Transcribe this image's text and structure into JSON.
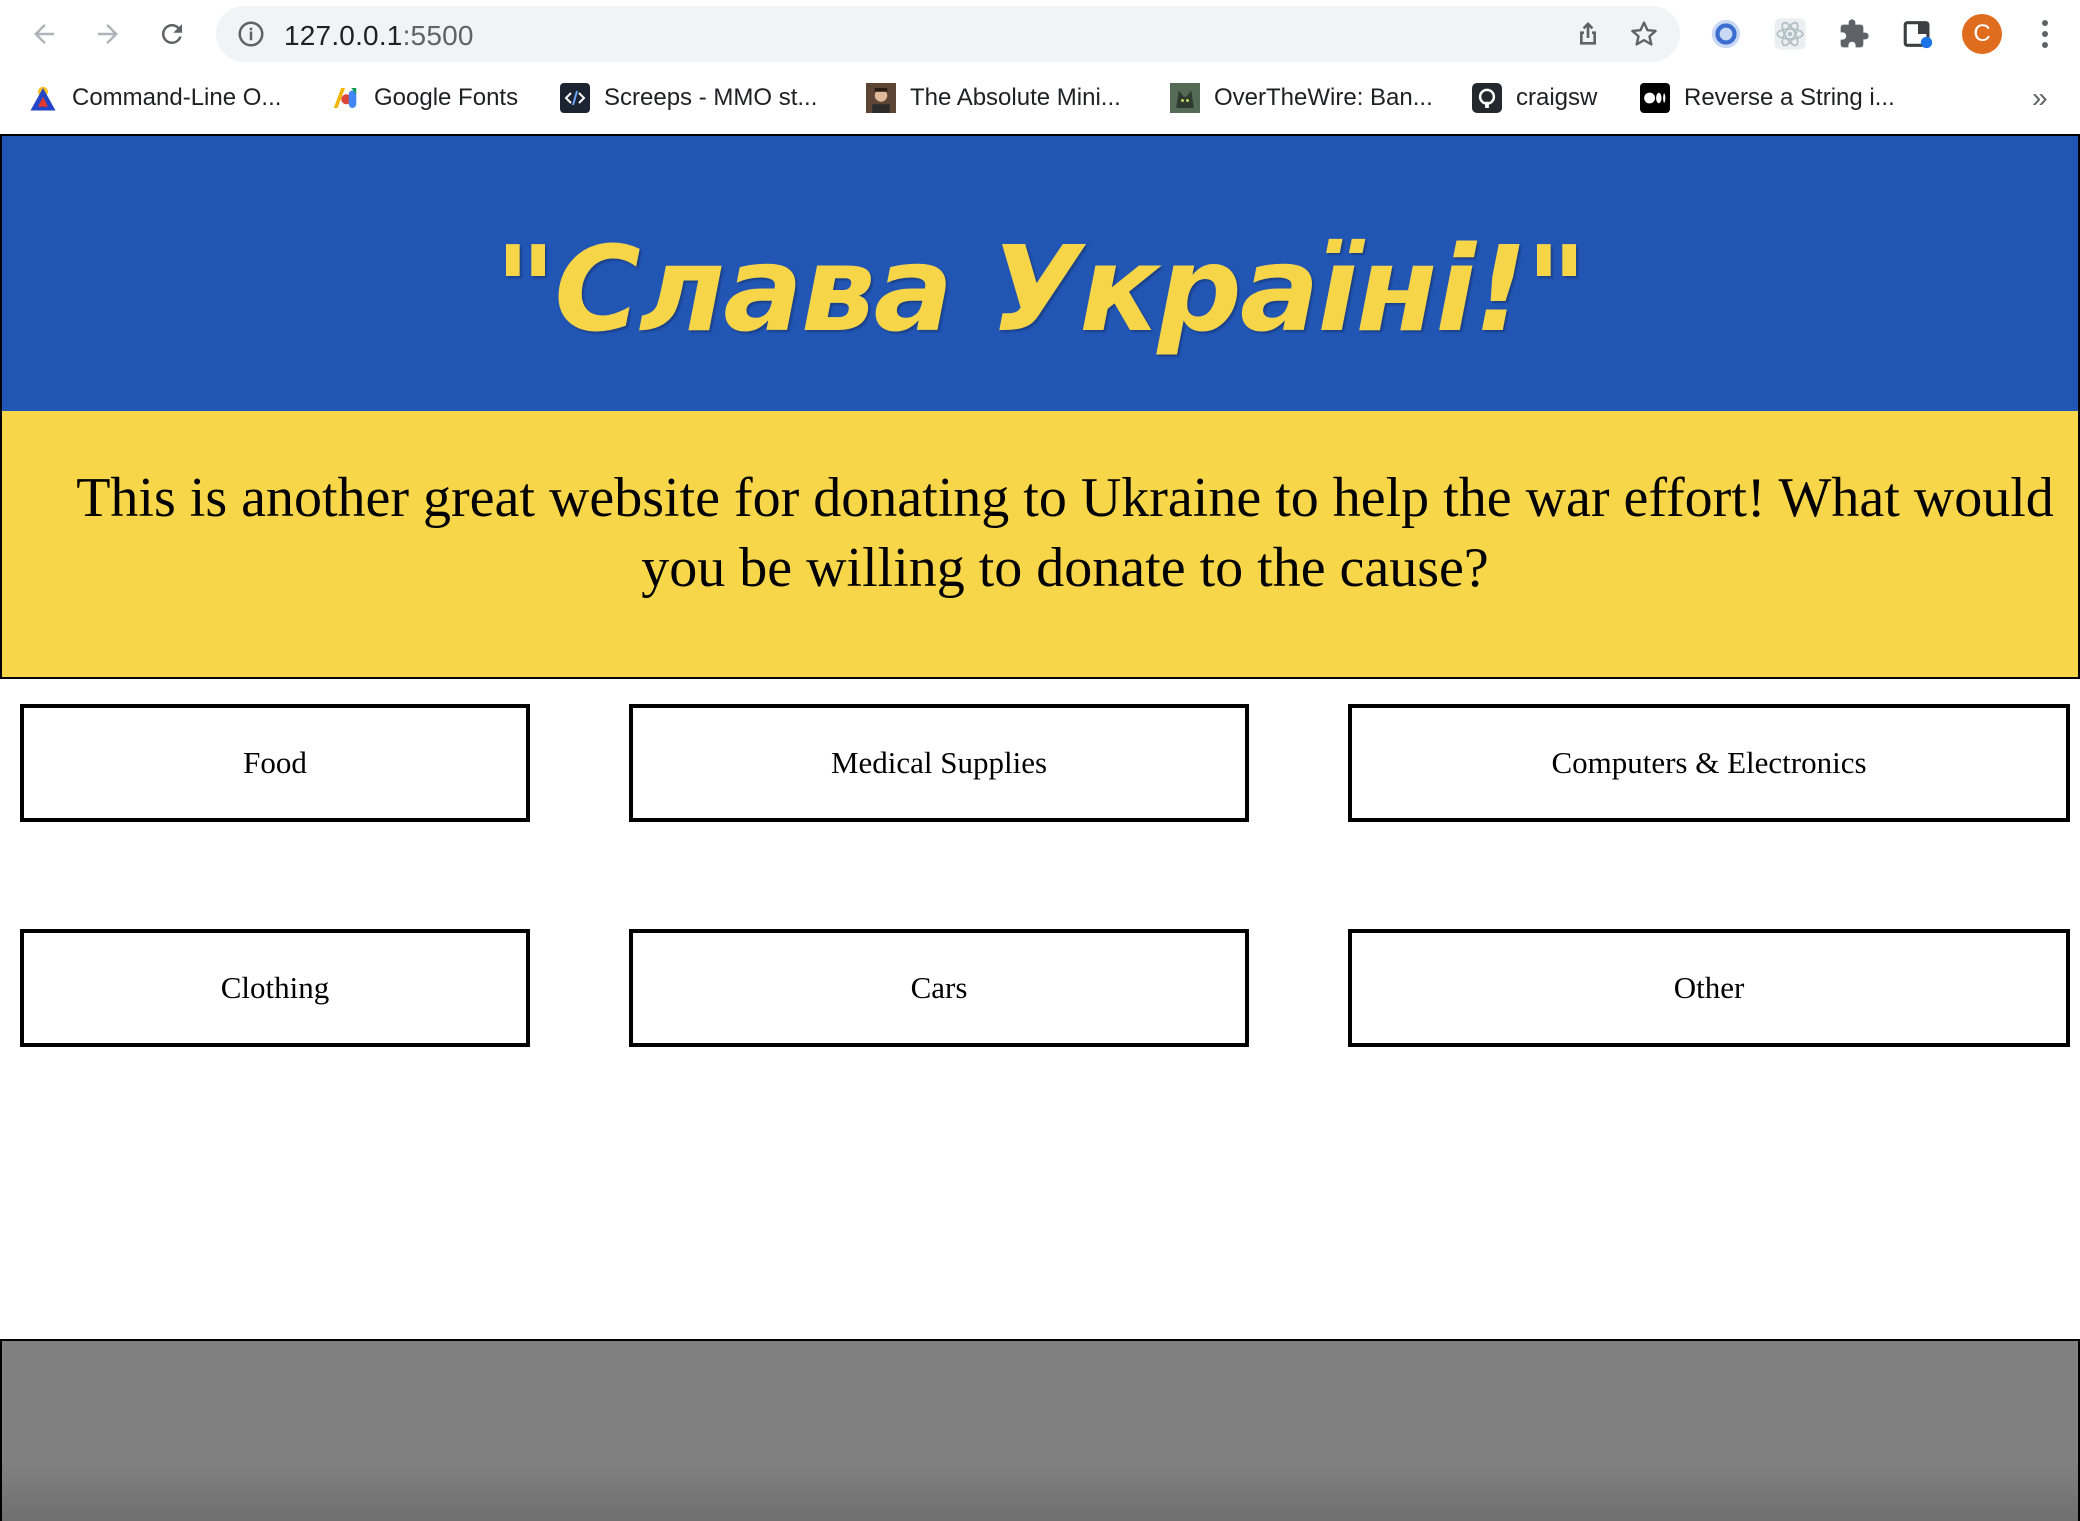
{
  "browser": {
    "url_host": "127.0.0.1",
    "url_port": ":5500",
    "avatar_letter": "C",
    "bookmarks": [
      {
        "label": "Command-Line O...",
        "icon": "triangle-logo-icon"
      },
      {
        "label": "Google Fonts",
        "icon": "google-fonts-icon"
      },
      {
        "label": "Screeps - MMO st...",
        "icon": "code-brackets-icon"
      },
      {
        "label": "The Absolute Mini...",
        "icon": "person-photo-icon"
      },
      {
        "label": "OverTheWire: Ban...",
        "icon": "cat-photo-icon"
      },
      {
        "label": "craigsw",
        "icon": "github-icon"
      },
      {
        "label": "Reverse a String i...",
        "icon": "medium-icon"
      }
    ],
    "more_label": "»"
  },
  "hero": {
    "title": "\"Слава Україні!\"",
    "description": "This is another great website for donating to Ukraine to help the war effort! What would you be willing to donate to the cause?",
    "blue_color": "#2256b5",
    "yellow_color": "#f7d649"
  },
  "categories": [
    {
      "label": "Food"
    },
    {
      "label": "Medical Supplies"
    },
    {
      "label": "Computers & Electronics"
    },
    {
      "label": "Clothing"
    },
    {
      "label": "Cars"
    },
    {
      "label": "Other"
    }
  ]
}
